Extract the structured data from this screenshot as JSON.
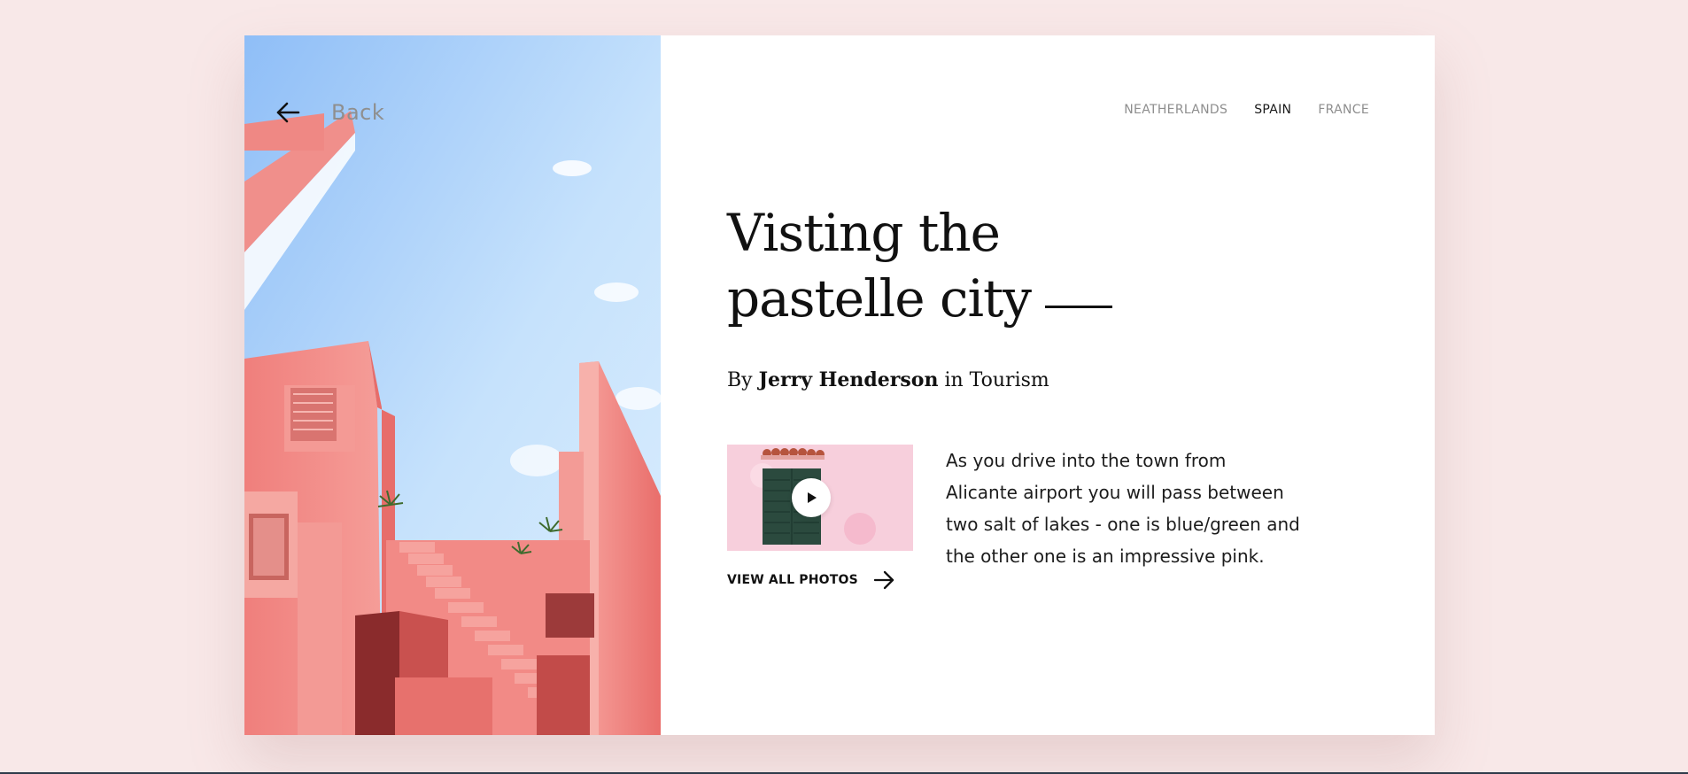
{
  "back": {
    "label": "Back"
  },
  "nav": {
    "items": [
      {
        "label": "NEATHERLANDS",
        "active": false
      },
      {
        "label": "SPAIN",
        "active": true
      },
      {
        "label": "FRANCE",
        "active": false
      }
    ]
  },
  "article": {
    "title_line1": "Visting the",
    "title_line2": "pastelle city",
    "byline_prefix": "By",
    "author": "Jerry Henderson",
    "byline_in": "in",
    "category": "Tourism",
    "description": "As you drive into the town from Alicante airport you will pass between two salt of lakes - one is blue/green and the other one is an impressive pink."
  },
  "media": {
    "view_all_label": "VIEW ALL PHOTOS"
  },
  "colors": {
    "page_background": "#f8e8e8",
    "card_background": "#ffffff",
    "building_pink": "#f08a87",
    "sky_blue": "#a9d4f8",
    "text_dark": "#111111",
    "text_muted": "#8e8e8e"
  },
  "icons": {
    "back": "arrow-left-icon",
    "view_all": "arrow-right-icon",
    "play": "play-icon"
  }
}
